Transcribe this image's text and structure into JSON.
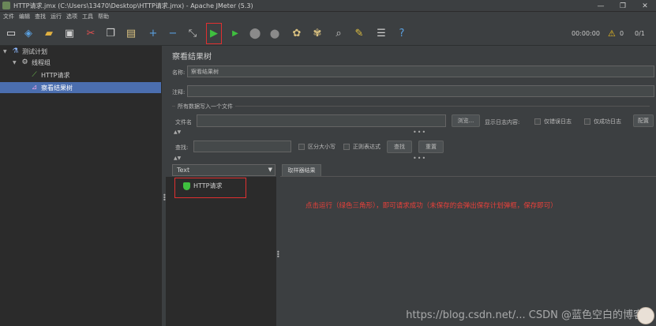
{
  "window": {
    "title": "HTTP请求.jmx (C:\\Users\\13470\\Desktop\\HTTP请求.jmx) - Apache JMeter (5.3)",
    "controls": [
      "—",
      "❐",
      "✕"
    ]
  },
  "menu": [
    "文件",
    "编辑",
    "查找",
    "运行",
    "选项",
    "工具",
    "帮助"
  ],
  "toolbar": {
    "elapsed": "00:00:00",
    "warnings": "0",
    "threads": "0/1"
  },
  "tree": {
    "test_plan": "测试计划",
    "thread_group": "线程组",
    "http_request": "HTTP请求",
    "view_results_tree": "察看结果树"
  },
  "panel": {
    "title": "察看结果树",
    "name_label": "名称:",
    "name_value": "察看结果树",
    "comment_label": "注释:",
    "comment_value": "",
    "section_label": "所有数据写入一个文件",
    "filename_label": "文件名",
    "filename_value": "",
    "browse_button": "浏览...",
    "log_content_label": "显示日志内容:",
    "errors_only": "仅错误日志",
    "success_only": "仅成功日志",
    "configure_button": "配置",
    "search_label": "查找:",
    "search_value": "",
    "case_sensitive": "区分大小写",
    "regex": "正则表达式",
    "find_button": "查找",
    "reset_button": "重置"
  },
  "results": {
    "renderer": "Text",
    "items": [
      "HTTP请求"
    ],
    "tab_label": "取样器结果"
  },
  "annotation": "点击运行（绿色三角形），即可请求成功（未保存的会弹出保存计划弹框，保存即可）",
  "watermark": "https://blog.csdn.net/...  CSDN @蓝色空白的博客"
}
